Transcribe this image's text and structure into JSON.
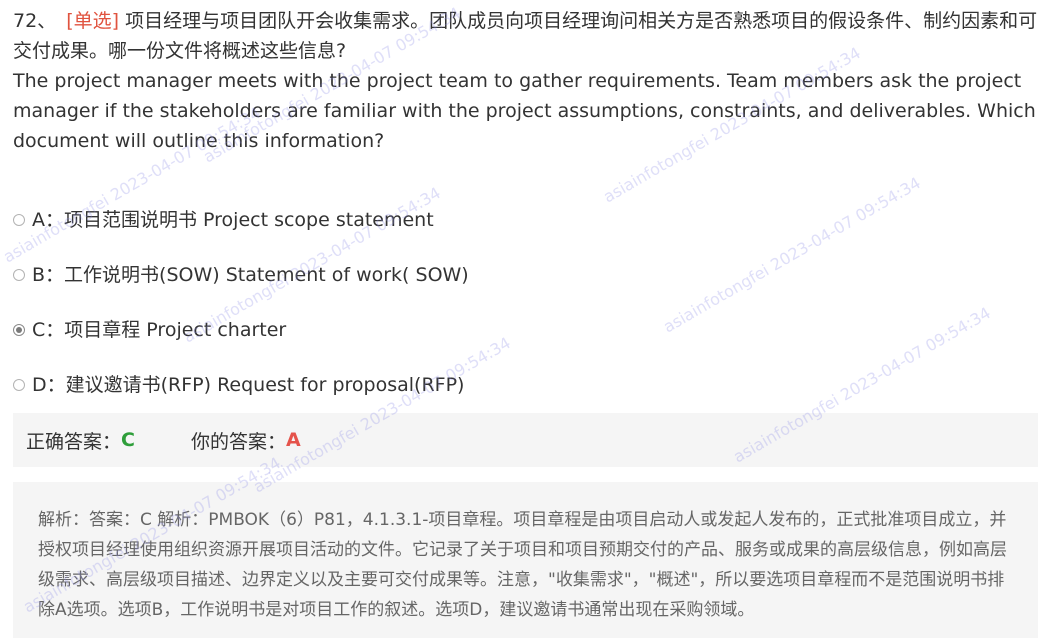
{
  "question": {
    "number": "72、",
    "type_label": "[单选]",
    "text_cn": "项目经理与项目团队开会收集需求。团队成员向项目经理询问相关方是否熟悉项目的假设条件、制约因素和可交付成果。哪一份文件将概述这些信息?",
    "text_en": "The project manager meets with the project team to gather requirements. Team members ask the project manager if the stakeholders are familiar with the project assumptions, constraints, and deliverables. Which document will outline this information?"
  },
  "options": [
    {
      "key": "A",
      "label": "A：项目范围说明书 Project scope statement",
      "selected": false
    },
    {
      "key": "B",
      "label": "B：工作说明书(SOW) Statement of work( SOW)",
      "selected": false
    },
    {
      "key": "C",
      "label": "C：项目章程 Project charter",
      "selected": true
    },
    {
      "key": "D",
      "label": "D：建议邀请书(RFP) Request for proposal(RFP)",
      "selected": false
    }
  ],
  "answer": {
    "correct_label": "正确答案：",
    "correct_value": "C",
    "yours_label": "你的答案：",
    "yours_value": "A"
  },
  "analysis": {
    "text": "解析：答案：C 解析：PMBOK（6）P81，4.1.3.1-项目章程。项目章程是由项目启动人或发起人发布的，正式批准项目成立，并授权项目经理使用组织资源开展项目活动的文件。它记录了关于项目和项目预期交付的产品、服务或成果的高层级信息，例如高层级需求、高层级项目描述、边界定义以及主要可交付成果等。注意，\"收集需求\"，\"概述\"，所以要选项目章程而不是范围说明书排除A选项。选项B，工作说明书是对项目工作的叙述。选项D，建议邀请书通常出现在采购领域。"
  },
  "watermark": {
    "text": "asiainfotongfei 2023-04-07 09:54:34"
  },
  "colors": {
    "type_label": "#e0533f",
    "correct": "#2e9e3a",
    "yours": "#e5534b"
  }
}
